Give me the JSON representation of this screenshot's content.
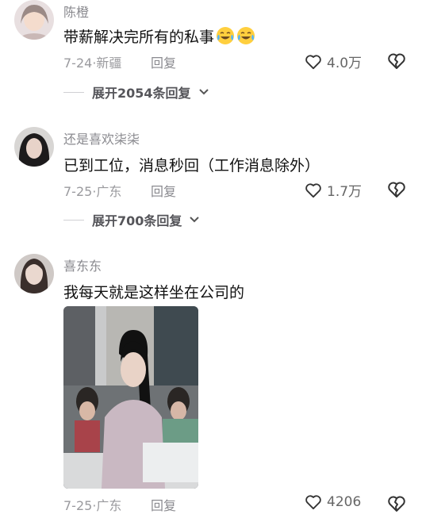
{
  "comments": [
    {
      "username": "陈橙",
      "text": "带薪解决完所有的私事",
      "emoji": [
        "crying-laughing-emoji",
        "crying-laughing-emoji"
      ],
      "date": "7-24",
      "location": "新疆",
      "reply_label": "回复",
      "likes": "4.0万",
      "expand_label": "展开2054条回复"
    },
    {
      "username": "还是喜欢柒柒",
      "text": "已到工位，消息秒回（工作消息除外）",
      "date": "7-25",
      "location": "广东",
      "reply_label": "回复",
      "likes": "1.7万",
      "expand_label": "展开700条回复"
    },
    {
      "username": "喜东东",
      "text": "我每天就是这样坐在公司的",
      "date": "7-25",
      "location": "广东",
      "reply_label": "回复",
      "likes": "4206"
    }
  ],
  "meta_separator": "·",
  "colors": {
    "text": "#111111",
    "muted": "#8a8a8f",
    "background": "#ffffff"
  }
}
